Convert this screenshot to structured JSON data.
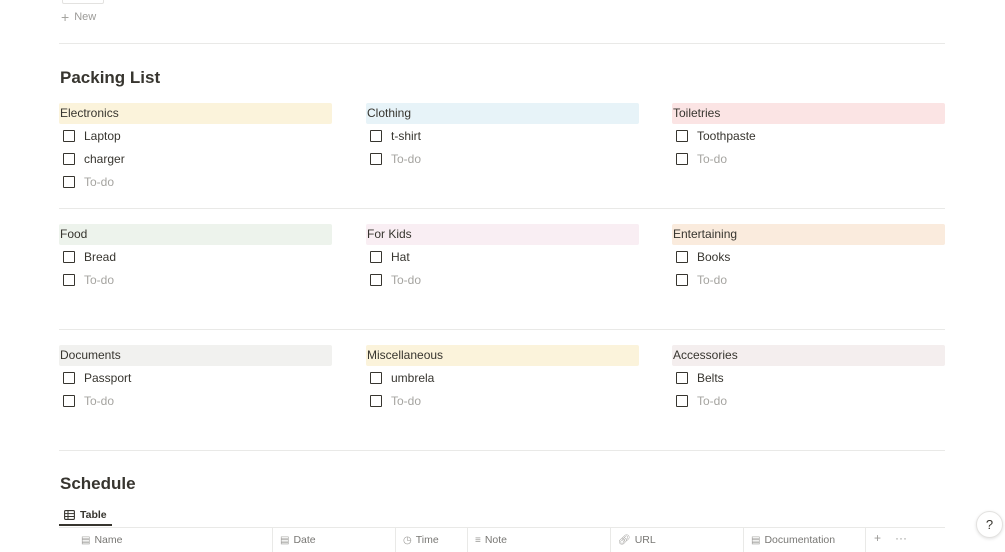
{
  "top": {
    "new_label": "New"
  },
  "packing": {
    "title": "Packing List",
    "placeholder": "To-do",
    "categories": [
      {
        "name": "Electronics",
        "color": "#fbf3db",
        "items": [
          "Laptop",
          "charger"
        ]
      },
      {
        "name": "Clothing",
        "color": "#e7f3f8",
        "items": [
          "t-shirt"
        ]
      },
      {
        "name": "Toiletries",
        "color": "#fbe4e4",
        "items": [
          "Toothpaste"
        ]
      },
      {
        "name": "Food",
        "color": "#edf3ec",
        "items": [
          "Bread"
        ]
      },
      {
        "name": "For Kids",
        "color": "#f9eef3",
        "items": [
          "Hat"
        ]
      },
      {
        "name": "Entertaining",
        "color": "#faebdd",
        "items": [
          "Books"
        ]
      },
      {
        "name": "Documents",
        "color": "#f1f1ef",
        "items": [
          "Passport"
        ]
      },
      {
        "name": "Miscellaneous",
        "color": "#fbf3db",
        "items": [
          "umbrela"
        ]
      },
      {
        "name": "Accessories",
        "color": "#f4eeee",
        "items": [
          "Belts"
        ]
      }
    ]
  },
  "schedule": {
    "title": "Schedule",
    "view_tab": "Table",
    "columns": [
      "Name",
      "Date",
      "Time",
      "Note",
      "URL",
      "Documentation"
    ],
    "add_symbol": "+",
    "more_symbol": "···"
  },
  "help": {
    "label": "?"
  }
}
